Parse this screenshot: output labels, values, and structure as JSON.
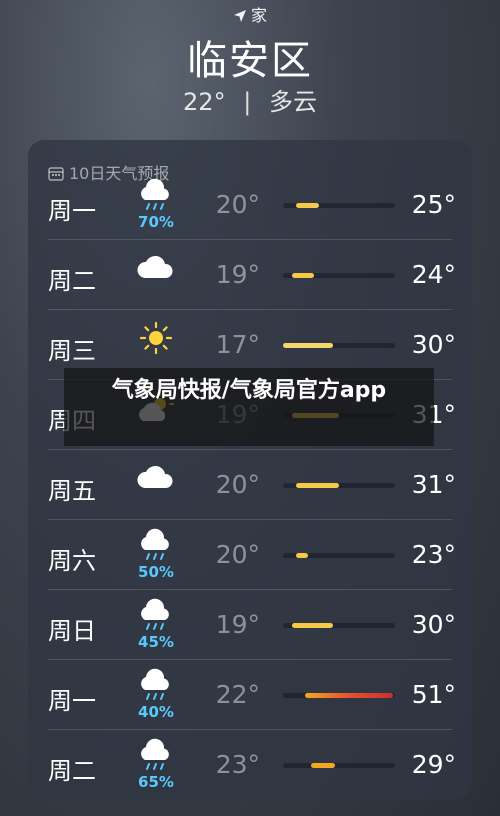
{
  "header": {
    "location_label": "家",
    "city": "临安区",
    "current_temp": "22°",
    "condition": "多云"
  },
  "forecast": {
    "title": "10日天气预报",
    "days": [
      {
        "day": "周一",
        "icon": "rain-cloud-icon",
        "precip": "70%",
        "low": "20°",
        "high": "25°",
        "range_start": 0.12,
        "range_end": 0.32,
        "bar_color": "#f7c948"
      },
      {
        "day": "周二",
        "icon": "cloud-icon",
        "precip": "",
        "low": "19°",
        "high": "24°",
        "range_start": 0.08,
        "range_end": 0.28,
        "bar_color": "#f7c948"
      },
      {
        "day": "周三",
        "icon": "sun-icon",
        "precip": "",
        "low": "17°",
        "high": "30°",
        "range_start": 0.0,
        "range_end": 0.45,
        "bar_color": "#f4d96a"
      },
      {
        "day": "周四",
        "icon": "partly-sunny-icon",
        "precip": "",
        "low": "19°",
        "high": "31°",
        "range_start": 0.08,
        "range_end": 0.5,
        "bar_color": "#f7c948"
      },
      {
        "day": "周五",
        "icon": "cloud-icon",
        "precip": "",
        "low": "20°",
        "high": "31°",
        "range_start": 0.12,
        "range_end": 0.5,
        "bar_color": "#f7c948"
      },
      {
        "day": "周六",
        "icon": "rain-cloud-icon",
        "precip": "50%",
        "low": "20°",
        "high": "23°",
        "range_start": 0.12,
        "range_end": 0.22,
        "bar_color": "#f7c948"
      },
      {
        "day": "周日",
        "icon": "rain-cloud-icon",
        "precip": "45%",
        "low": "19°",
        "high": "30°",
        "range_start": 0.08,
        "range_end": 0.45,
        "bar_color": "#f7c948"
      },
      {
        "day": "周一",
        "icon": "rain-cloud-icon",
        "precip": "40%",
        "low": "22°",
        "high": "51°",
        "range_start": 0.2,
        "range_end": 0.98,
        "bar_color": "#e8502e"
      },
      {
        "day": "周二",
        "icon": "rain-cloud-icon",
        "precip": "65%",
        "low": "23°",
        "high": "29°",
        "range_start": 0.25,
        "range_end": 0.46,
        "bar_color": "#f5a623"
      }
    ]
  },
  "overlay": {
    "text": "气象局快报/气象局官方app"
  }
}
